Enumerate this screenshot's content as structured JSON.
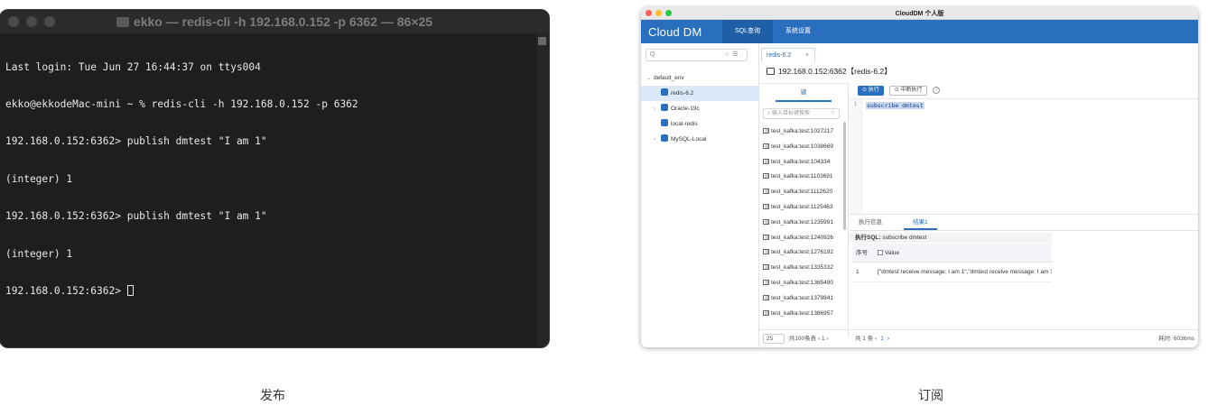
{
  "terminal": {
    "title": "ekko — redis-cli -h 192.168.0.152 -p 6362 — 86×25",
    "lines": [
      "Last login: Tue Jun 27 16:44:37 on ttys004",
      "ekko@ekkodeMac-mini ~ % redis-cli -h 192.168.0.152 -p 6362",
      "192.168.0.152:6362> publish dmtest \"I am 1\"",
      "(integer) 1",
      "192.168.0.152:6362> publish dmtest \"I am 1\"",
      "(integer) 1",
      "192.168.0.152:6362> "
    ],
    "caption": "发布"
  },
  "clouddm": {
    "window_title": "CloudDM 个人版",
    "logo": "Cloud DM",
    "nav_tabs": [
      "SQL查询",
      "系统设置"
    ],
    "search_placeholder": "Q",
    "tree": {
      "env": "default_env",
      "items": [
        {
          "label": "redis-6.2",
          "color": "#2a6fbd",
          "selected": true
        },
        {
          "label": "Oracle-19c",
          "color": "#2a6fbd",
          "selected": false
        },
        {
          "label": "local-redis",
          "color": "#2a6fbd",
          "selected": false
        },
        {
          "label": "MySQL-Local",
          "color": "#2a6fbd",
          "selected": false
        }
      ]
    },
    "doc_tab": "redis-6.2",
    "doc_tab_close": "×",
    "connection": "192.168.0.152:6362【redis-6.2】",
    "keys": {
      "header": "键",
      "search_placeholder": "输入目标键搜索",
      "items": [
        "test_kafka:test:1027217",
        "test_kafka:test:1038669",
        "test_kafka:test:104334",
        "test_kafka:test:1103691",
        "test_kafka:test:1112620",
        "test_kafka:test:1125463",
        "test_kafka:test:1235991",
        "test_kafka:test:1240926",
        "test_kafka:test:1276192",
        "test_kafka:test:1335332",
        "test_kafka:test:1365490",
        "test_kafka:test:1379841",
        "test_kafka:test:1386957"
      ],
      "page_size": "25",
      "total": "共100条表",
      "page": "1"
    },
    "editor": {
      "run_label": "⊙ 执行",
      "stop_label": "⊙ 中断执行",
      "help": "?",
      "line_no": "1",
      "code": "subscribe dmtest"
    },
    "results": {
      "tabs": [
        "执行信息",
        "结果1"
      ],
      "sql_prefix": "执行SQL:",
      "sql": "subscribe dmtest",
      "col_index": "序号",
      "col_value": "Value",
      "rows": [
        {
          "n": "1",
          "value": "[\"dmtest receive message: I am 1\",\"dmtest receive message: I am 1"
        }
      ],
      "total": "共 1 条",
      "page": "1",
      "elapsed": "耗时: 6036ms"
    },
    "caption": "订阅"
  }
}
